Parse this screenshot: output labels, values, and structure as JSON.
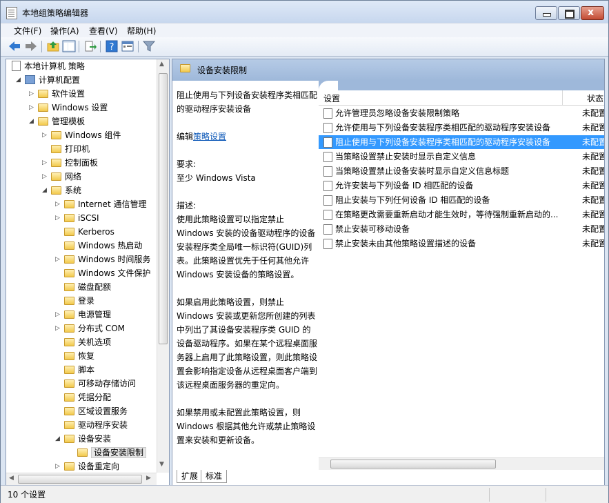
{
  "window": {
    "title": "本地组策略编辑器"
  },
  "menu": [
    "文件(F)",
    "操作(A)",
    "查看(V)",
    "帮助(H)"
  ],
  "toolbar": {
    "icons": [
      "back-arrow-icon",
      "forward-arrow-icon",
      "up-folder-icon",
      "show-tree-icon",
      "export-icon",
      "help-icon",
      "properties-icon",
      "filter-icon"
    ]
  },
  "tree": {
    "items": [
      {
        "label": "本地计算机 策略",
        "level": 0,
        "icon": "policy",
        "expanded": "none"
      },
      {
        "label": "计算机配置",
        "level": 1,
        "icon": "pc",
        "expanded": "open"
      },
      {
        "label": "软件设置",
        "level": 2,
        "icon": "folder",
        "expanded": "closed"
      },
      {
        "label": "Windows 设置",
        "level": 2,
        "icon": "folder",
        "expanded": "closed"
      },
      {
        "label": "管理模板",
        "level": 2,
        "icon": "folder",
        "expanded": "open"
      },
      {
        "label": "Windows 组件",
        "level": 3,
        "icon": "folder",
        "expanded": "closed"
      },
      {
        "label": "打印机",
        "level": 3,
        "icon": "folder",
        "expanded": "none"
      },
      {
        "label": "控制面板",
        "level": 3,
        "icon": "folder",
        "expanded": "closed"
      },
      {
        "label": "网络",
        "level": 3,
        "icon": "folder",
        "expanded": "closed"
      },
      {
        "label": "系统",
        "level": 3,
        "icon": "folder",
        "expanded": "open"
      },
      {
        "label": "Internet 通信管理",
        "level": 4,
        "icon": "folder",
        "expanded": "closed"
      },
      {
        "label": "iSCSI",
        "level": 4,
        "icon": "folder",
        "expanded": "closed"
      },
      {
        "label": "Kerberos",
        "level": 4,
        "icon": "folder",
        "expanded": "none"
      },
      {
        "label": "Windows 热启动",
        "level": 4,
        "icon": "folder",
        "expanded": "none"
      },
      {
        "label": "Windows 时间服务",
        "level": 4,
        "icon": "folder",
        "expanded": "closed"
      },
      {
        "label": "Windows 文件保护",
        "level": 4,
        "icon": "folder",
        "expanded": "none"
      },
      {
        "label": "磁盘配额",
        "level": 4,
        "icon": "folder",
        "expanded": "none"
      },
      {
        "label": "登录",
        "level": 4,
        "icon": "folder",
        "expanded": "none"
      },
      {
        "label": "电源管理",
        "level": 4,
        "icon": "folder",
        "expanded": "closed"
      },
      {
        "label": "分布式 COM",
        "level": 4,
        "icon": "folder",
        "expanded": "closed"
      },
      {
        "label": "关机选项",
        "level": 4,
        "icon": "folder",
        "expanded": "none"
      },
      {
        "label": "恢复",
        "level": 4,
        "icon": "folder",
        "expanded": "none"
      },
      {
        "label": "脚本",
        "level": 4,
        "icon": "folder",
        "expanded": "none"
      },
      {
        "label": "可移动存储访问",
        "level": 4,
        "icon": "folder",
        "expanded": "none"
      },
      {
        "label": "凭据分配",
        "level": 4,
        "icon": "folder",
        "expanded": "none"
      },
      {
        "label": "区域设置服务",
        "level": 4,
        "icon": "folder",
        "expanded": "none"
      },
      {
        "label": "驱动程序安装",
        "level": 4,
        "icon": "folder",
        "expanded": "none"
      },
      {
        "label": "设备安装",
        "level": 4,
        "icon": "folder",
        "expanded": "open"
      },
      {
        "label": "设备安装限制",
        "level": 5,
        "icon": "folder",
        "expanded": "none",
        "selected": true
      },
      {
        "label": "设备重定向",
        "level": 4,
        "icon": "folder",
        "expanded": "closed"
      }
    ]
  },
  "right": {
    "header_title": "设备安装限制",
    "detail": {
      "title": "阻止使用与下列设备安装程序类相匹配的驱动程序安装设备",
      "edit_prefix": "编辑",
      "edit_link": "策略设置",
      "requirements_label": "要求:",
      "requirements_value": "至少 Windows Vista",
      "description_label": "描述:",
      "description_1": "使用此策略设置可以指定禁止 Windows 安装的设备驱动程序的设备安装程序类全局唯一标识符(GUID)列表。此策略设置优先于任何其他允许 Windows 安装设备的策略设置。",
      "description_2": "如果启用此策略设置，则禁止 Windows 安装或更新您所创建的列表中列出了其设备安装程序类 GUID 的设备驱动程序。如果在某个远程桌面服务器上启用了此策略设置，则此策略设置会影响指定设备从远程桌面客户端到该远程桌面服务器的重定向。",
      "description_3": "如果禁用或未配置此策略设置，则 Windows 根据其他允许或禁止策略设置来安装和更新设备。"
    },
    "columns": {
      "setting": "设置",
      "state": "状态"
    },
    "rows": [
      {
        "name": "允许管理员忽略设备安装限制策略",
        "state": "未配置"
      },
      {
        "name": "允许使用与下列设备安装程序类相匹配的驱动程序安装设备",
        "state": "未配置"
      },
      {
        "name": "阻止使用与下列设备安装程序类相匹配的驱动程序安装设备",
        "state": "未配置",
        "selected": true
      },
      {
        "name": "当策略设置禁止安装时显示自定义信息",
        "state": "未配置"
      },
      {
        "name": "当策略设置禁止设备安装时显示自定义信息标题",
        "state": "未配置"
      },
      {
        "name": "允许安装与下列设备 ID 相匹配的设备",
        "state": "未配置"
      },
      {
        "name": "阻止安装与下列任何设备 ID 相匹配的设备",
        "state": "未配置"
      },
      {
        "name": "在策略更改需要重新启动才能生效时，等待强制重新启动的...",
        "state": "未配置"
      },
      {
        "name": "禁止安装可移动设备",
        "state": "未配置"
      },
      {
        "name": "禁止安装未由其他策略设置描述的设备",
        "state": "未配置"
      }
    ],
    "tabs": [
      "扩展",
      "标准"
    ]
  },
  "status": {
    "text": "10 个设置"
  }
}
